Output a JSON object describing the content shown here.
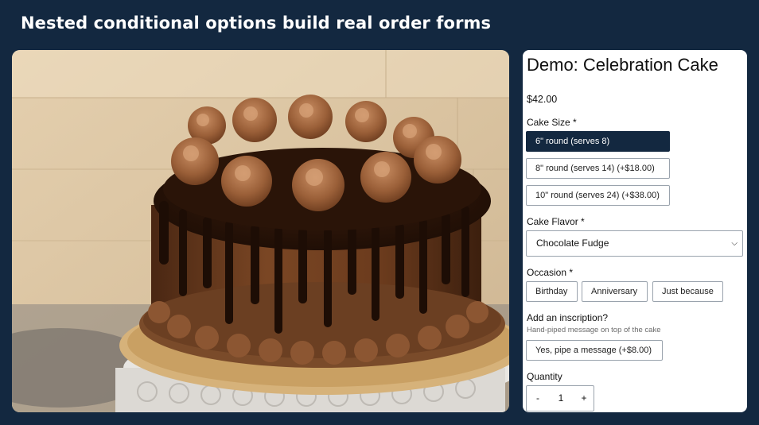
{
  "headline": "Nested conditional options build real order forms",
  "product": {
    "title": "Demo: Celebration Cake",
    "price": "$42.00",
    "image_alt": "Chocolate drip cake with piped frosting swirls on a cake stand"
  },
  "size": {
    "label": "Cake Size *",
    "options": [
      {
        "label": "6\" round (serves 8)",
        "selected": true
      },
      {
        "label": "8\" round (serves 14) (+$18.00)",
        "selected": false
      },
      {
        "label": "10\" round (serves 24) (+$38.00)",
        "selected": false
      }
    ]
  },
  "flavor": {
    "label": "Cake Flavor *",
    "selected": "Chocolate Fudge"
  },
  "occasion": {
    "label": "Occasion *",
    "options": [
      {
        "label": "Birthday"
      },
      {
        "label": "Anniversary"
      },
      {
        "label": "Just because"
      }
    ]
  },
  "inscription": {
    "label": "Add an inscription?",
    "hint": "Hand-piped message on top of the cake",
    "button": "Yes, pipe a message (+$8.00)"
  },
  "quantity": {
    "label": "Quantity",
    "value": "1",
    "minus": "-",
    "plus": "+"
  },
  "colors": {
    "background": "#132840",
    "selected": "#132840",
    "panel": "#ffffff"
  }
}
